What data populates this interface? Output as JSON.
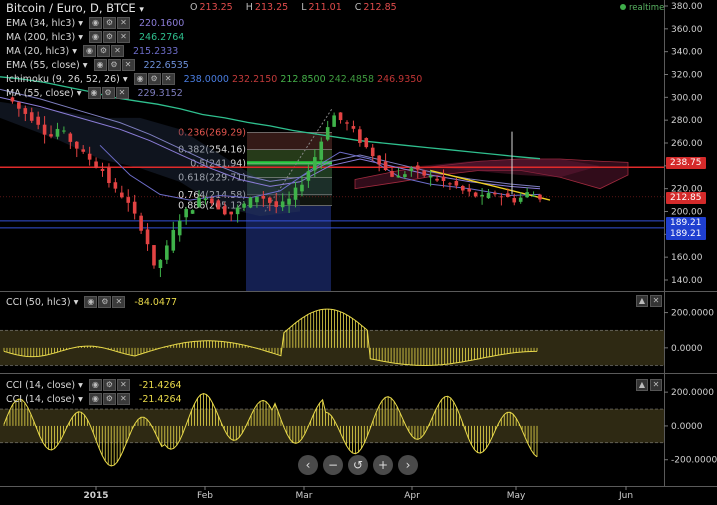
{
  "header": {
    "symbol": "Bitcoin / Euro, D, BTCE",
    "ohlc": [
      {
        "k": "O",
        "v": "213.25"
      },
      {
        "k": "H",
        "v": "213.25"
      },
      {
        "k": "L",
        "v": "211.01"
      },
      {
        "k": "C",
        "v": "212.85"
      }
    ],
    "realtime_label": "realtime"
  },
  "indicators": [
    {
      "label": "EMA (34, hlc3)",
      "value": "220.1600",
      "color": "#8a7cd6"
    },
    {
      "label": "MA (200, hlc3)",
      "value": "246.2764",
      "color": "#2fbf8e"
    },
    {
      "label": "MA (20, hlc3)",
      "value": "215.2333",
      "color": "#6d6dc9"
    },
    {
      "label": "EMA (55, close)",
      "value": "222.6535",
      "color": "#6c8fd8"
    },
    {
      "label": "Ichimoku (9, 26, 52, 26)",
      "values": [
        {
          "v": "238.0000",
          "c": "#4a7de0"
        },
        {
          "v": "232.2150",
          "c": "#c23a3a"
        },
        {
          "v": "212.8500",
          "c": "#44b049"
        },
        {
          "v": "242.4858",
          "c": "#3f9a3f"
        },
        {
          "v": "246.9350",
          "c": "#c03535"
        }
      ]
    },
    {
      "label": "MA (55, close)",
      "value": "229.3152",
      "color": "#7e7ebf"
    }
  ],
  "fib_labels": [
    {
      "text": "0.236(269.29)",
      "c": "#e2554e"
    },
    {
      "text": "0.382(254.16)",
      "c": "#d9d9d9"
    },
    {
      "text": "0.5(241.94)",
      "c": "#d9d9d9"
    },
    {
      "text": "0.618(229.71)",
      "c": "#d9d9d9"
    },
    {
      "text": "0.764(214.58)",
      "c": "#d9d9d9"
    },
    {
      "text": "0.886(205.12)",
      "c": "#d9d9d9"
    }
  ],
  "price_axis": {
    "ticks": [
      "380.00",
      "360.00",
      "340.00",
      "320.00",
      "300.00",
      "280.00",
      "260.00",
      "240.00",
      "220.00",
      "200.00",
      "180.00",
      "160.00",
      "140.00"
    ],
    "tags": [
      {
        "text": "238.75",
        "bg": "#d42a2a"
      },
      {
        "text": "212.85",
        "bg": "#d42a2a"
      },
      {
        "text": "189.21",
        "bg": "#1f3fd0"
      },
      {
        "text": "189.21",
        "bg": "#1f3fd0"
      }
    ]
  },
  "cci1": {
    "label": "CCI (50, hlc3)",
    "value": "-84.0477",
    "ticks": [
      "200.0000",
      "0.0000"
    ]
  },
  "cci2": {
    "labels": [
      {
        "label": "CCI (14, close)",
        "value": "-21.4264"
      },
      {
        "label": "CCI (14, close)",
        "value": "-21.4264"
      }
    ],
    "ticks": [
      "200.0000",
      "0.0000",
      "-200.0000"
    ]
  },
  "time_axis": [
    "2015",
    "Feb",
    "Mar",
    "Apr",
    "May",
    "Jun"
  ],
  "nav_buttons": [
    "‹",
    "−",
    "↺",
    "+",
    "›"
  ],
  "chart_data": {
    "type": "line",
    "series": [
      {
        "name": "Bitcoin / Euro, D, BTCE",
        "values": [
          298,
          292,
          284,
          272,
          265,
          250,
          238,
          225,
          215,
          205,
          188,
          160,
          150,
          170,
          188,
          198,
          210,
          218,
          230,
          225,
          212,
          205,
          200,
          205,
          215,
          225,
          235,
          250,
          268,
          275,
          265,
          250,
          240,
          232,
          230,
          228,
          225,
          222,
          220,
          218,
          215,
          212,
          212.85
        ]
      },
      {
        "name": "MA (200, hlc3)",
        "values": [
          318,
          316,
          313,
          309,
          305,
          300,
          297,
          294,
          290,
          285,
          282,
          278,
          275,
          271,
          268,
          265,
          262,
          260,
          258,
          256,
          254,
          252,
          250,
          248,
          246.2764
        ]
      }
    ],
    "ylim": [
      130,
      390
    ]
  }
}
